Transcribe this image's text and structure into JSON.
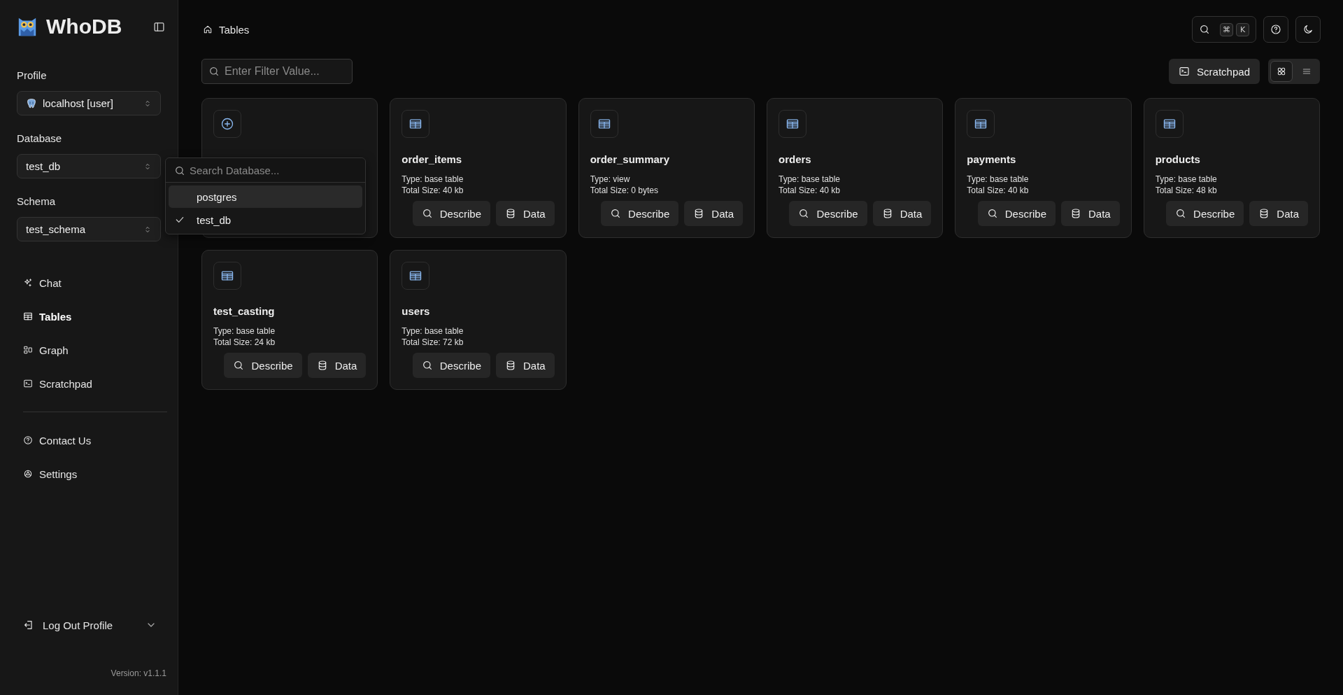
{
  "app": {
    "name": "WhoDB"
  },
  "sidebar": {
    "selects": [
      {
        "label": "Profile",
        "value": "localhost [user]",
        "kind": "profile"
      },
      {
        "label": "Database",
        "value": "test_db",
        "kind": "plain"
      },
      {
        "label": "Schema",
        "value": "test_schema",
        "kind": "plain"
      }
    ],
    "nav": [
      {
        "label": "Chat",
        "kind": "chat",
        "selected": false
      },
      {
        "label": "Tables",
        "kind": "tables",
        "selected": true
      },
      {
        "label": "Graph",
        "kind": "graph",
        "selected": false
      },
      {
        "label": "Scratchpad",
        "kind": "terminal",
        "selected": false
      }
    ],
    "footer_nav": [
      {
        "label": "Contact Us",
        "kind": "help"
      },
      {
        "label": "Settings",
        "kind": "settings"
      }
    ],
    "logout": "Log Out Profile",
    "version": "Version: v1.1.1"
  },
  "breadcrumb": "Tables",
  "search_shortcut": {
    "keys": [
      "⌘",
      "K"
    ]
  },
  "filter": {
    "placeholder": "Enter Filter Value..."
  },
  "scratchpad_button": "Scratchpad",
  "view_toggle": [
    {
      "kind": "grid",
      "selected": true
    },
    {
      "kind": "list",
      "selected": false
    }
  ],
  "create_card": {
    "kind": "create"
  },
  "tables": [
    {
      "name": "order_items",
      "type": "Type: base table",
      "size": "Total Size: 40 kb",
      "actions": [
        {
          "kind": "describe",
          "label": "Describe"
        },
        {
          "kind": "data",
          "label": "Data"
        }
      ]
    },
    {
      "name": "order_summary",
      "type": "Type: view",
      "size": "Total Size: 0 bytes",
      "actions": [
        {
          "kind": "describe",
          "label": "Describe"
        },
        {
          "kind": "data",
          "label": "Data"
        }
      ]
    },
    {
      "name": "orders",
      "type": "Type: base table",
      "size": "Total Size: 40 kb",
      "actions": [
        {
          "kind": "describe",
          "label": "Describe"
        },
        {
          "kind": "data",
          "label": "Data"
        }
      ]
    },
    {
      "name": "payments",
      "type": "Type: base table",
      "size": "Total Size: 40 kb",
      "actions": [
        {
          "kind": "describe",
          "label": "Describe"
        },
        {
          "kind": "data",
          "label": "Data"
        }
      ]
    },
    {
      "name": "products",
      "type": "Type: base table",
      "size": "Total Size: 48 kb",
      "actions": [
        {
          "kind": "describe",
          "label": "Describe"
        },
        {
          "kind": "data",
          "label": "Data"
        }
      ]
    },
    {
      "name": "test_casting",
      "type": "Type: base table",
      "size": "Total Size: 24 kb",
      "actions": [
        {
          "kind": "describe",
          "label": "Describe"
        },
        {
          "kind": "data",
          "label": "Data"
        }
      ]
    },
    {
      "name": "users",
      "type": "Type: base table",
      "size": "Total Size: 72 kb",
      "actions": [
        {
          "kind": "describe",
          "label": "Describe"
        },
        {
          "kind": "data",
          "label": "Data"
        }
      ]
    }
  ],
  "database_dropdown": {
    "placeholder": "Search Database...",
    "options": [
      {
        "label": "postgres",
        "selected": false,
        "highlighted": true
      },
      {
        "label": "test_db",
        "selected": true,
        "highlighted": false
      }
    ]
  }
}
